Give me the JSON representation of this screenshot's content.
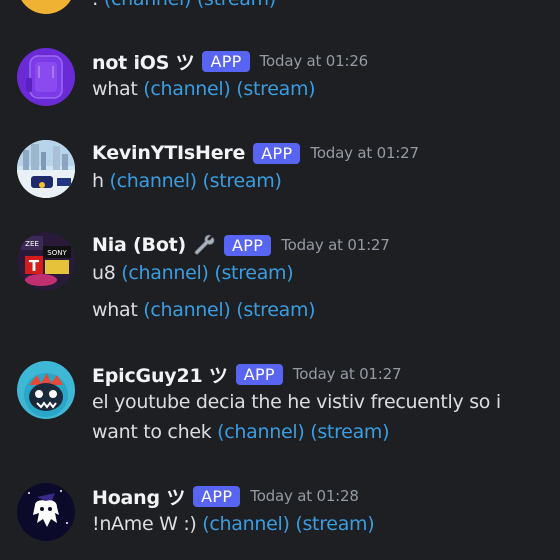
{
  "top_partial": {
    "text_prefix": ": ",
    "link1": "(channel)",
    "link2": "(stream)"
  },
  "messages": [
    {
      "username": "not iOS ツ",
      "badge": "APP",
      "timestamp": "Today at 01:26",
      "lines": [
        {
          "text": "what ",
          "link1": "(channel)",
          "link2": "(stream)"
        }
      ]
    },
    {
      "username": "KevinYTIsHere",
      "badge": "APP",
      "timestamp": "Today at 01:27",
      "lines": [
        {
          "text": "h ",
          "link1": "(channel)",
          "link2": "(stream)"
        }
      ]
    },
    {
      "username": "Nia (Bot)",
      "badge": "APP",
      "timestamp": "Today at 01:27",
      "lines": [
        {
          "text": "u8 ",
          "link1": "(channel)",
          "link2": "(stream)"
        },
        {
          "text": "what ",
          "link1": "(channel)",
          "link2": "(stream)"
        }
      ]
    },
    {
      "username": "EpicGuy21 ツ",
      "badge": "APP",
      "timestamp": "Today at 01:27",
      "lines": [
        {
          "text": "el youtube decia the he vistiv frecuently so i",
          "link1": "",
          "link2": ""
        },
        {
          "text": "want to chek ",
          "link1": "(channel)",
          "link2": "(stream)"
        }
      ]
    },
    {
      "username": "Hoang ツ",
      "badge": "APP",
      "timestamp": "Today at 01:28",
      "lines": [
        {
          "text": "!nAme W :) ",
          "link1": "(channel)",
          "link2": "(stream)"
        }
      ]
    }
  ],
  "avatar_labels": {
    "nia_top": "ZEE",
    "nia_mid": "SONY",
    "nia_letter": "T"
  },
  "icons": {
    "bot_tool": "wrench-icon"
  },
  "colors": {
    "background": "#1e1f22",
    "username": "#f2f3f5",
    "badge": "#5865f2",
    "timestamp": "#949ba4",
    "link": "#3b9de1",
    "text": "#dbdee1"
  }
}
